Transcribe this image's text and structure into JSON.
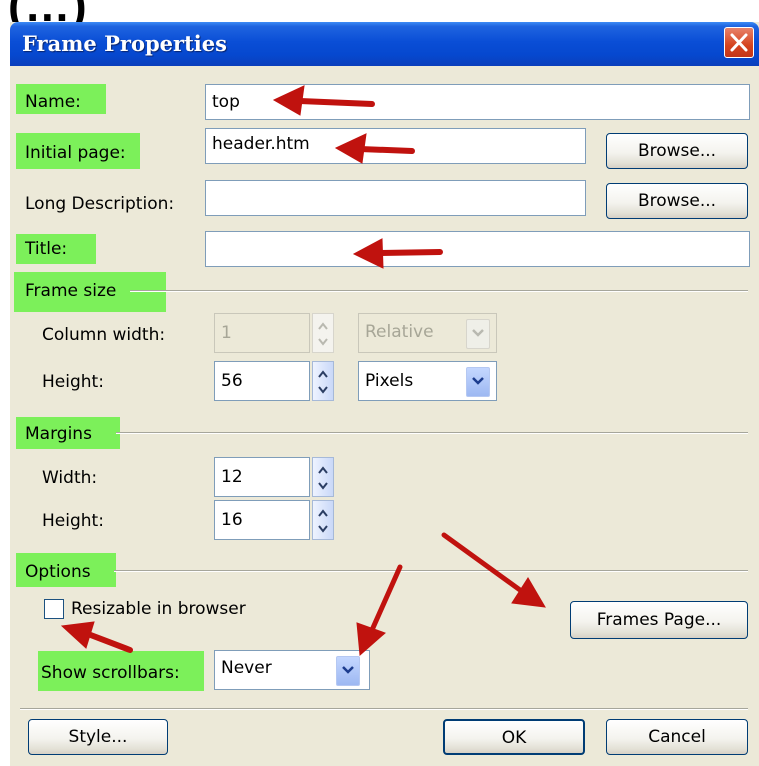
{
  "page_heading_fragment": "(…)",
  "window": {
    "title": "Frame Properties",
    "close_label": "close"
  },
  "fields": {
    "name_label": "Name:",
    "name_value": "top",
    "initial_page_label": "Initial page:",
    "initial_page_value": "header.htm",
    "long_description_label": "Long Description:",
    "long_description_value": "",
    "title_label": "Title:",
    "title_value": "",
    "browse_label": "Browse..."
  },
  "frame_size": {
    "section_label": "Frame size",
    "column_width_label": "Column width:",
    "column_width_value": "1",
    "column_width_unit": "Relative",
    "height_label": "Height:",
    "height_value": "56",
    "height_unit": "Pixels"
  },
  "margins": {
    "section_label": "Margins",
    "width_label": "Width:",
    "width_value": "12",
    "height_label": "Height:",
    "height_value": "16"
  },
  "options": {
    "section_label": "Options",
    "resizable_label": "Resizable in browser",
    "resizable_checked": false,
    "scrollbars_label": "Show scrollbars:",
    "scrollbars_value": "Never",
    "frames_page_label": "Frames Page..."
  },
  "footer": {
    "style_label": "Style...",
    "ok_label": "OK",
    "cancel_label": "Cancel"
  },
  "colors": {
    "highlight": "#7cf05a",
    "annotation_arrow": "#c0120e",
    "titlebar": "#0a4ed6",
    "dialog_bg": "#ece9d8"
  }
}
